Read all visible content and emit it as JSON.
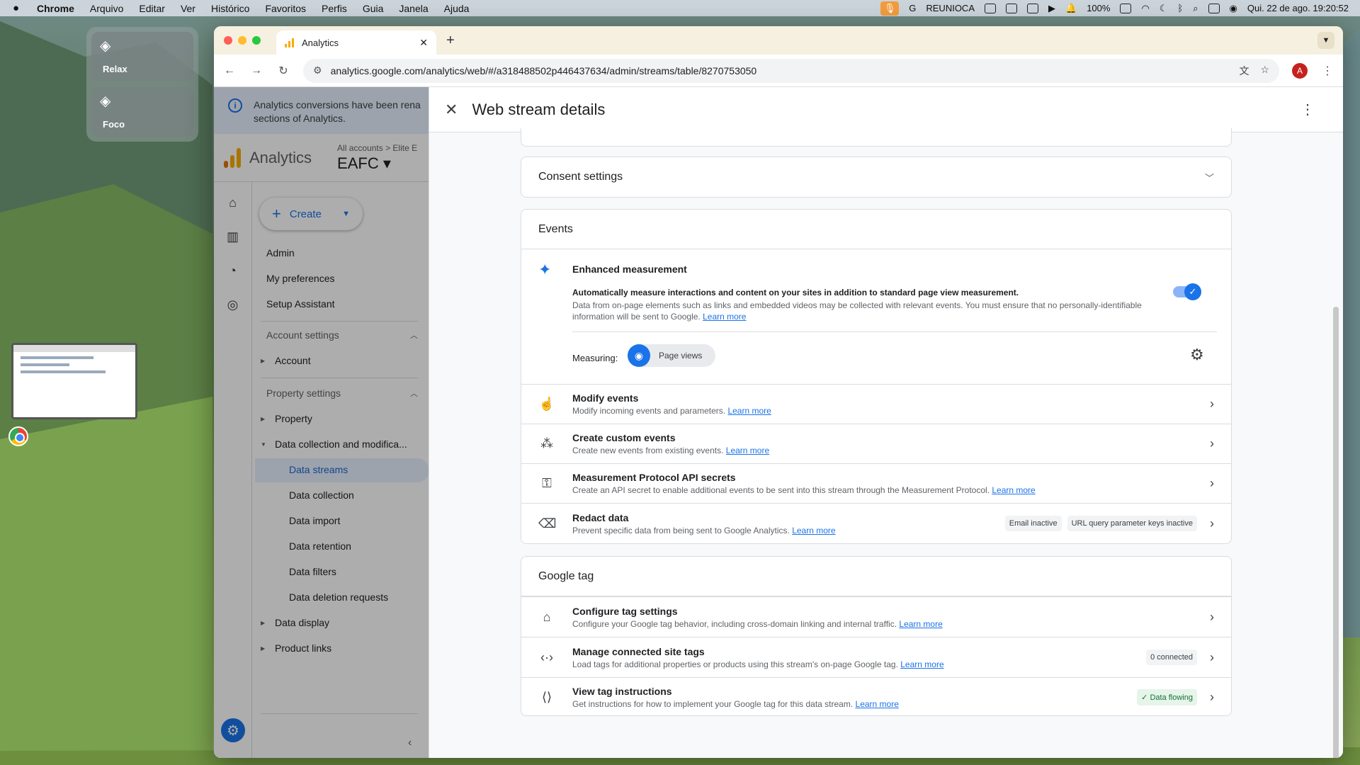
{
  "menubar": {
    "app": "Chrome",
    "items": [
      "Arquivo",
      "Editar",
      "Ver",
      "Histórico",
      "Favoritos",
      "Perfis",
      "Guia",
      "Janela",
      "Ajuda"
    ],
    "tray_label": "REUNIOCA",
    "battery": "100%",
    "datetime": "Qui. 22 de ago.  19:20:52"
  },
  "focus": {
    "relax": "Relax",
    "foco": "Foco"
  },
  "browser": {
    "tab_title": "Analytics",
    "url": "analytics.google.com/analytics/web/#/a318488502p446437634/admin/streams/table/8270753050",
    "avatar": "A"
  },
  "ga": {
    "banner": "Analytics conversions have been rena\nsections of Analytics.",
    "product": "Analytics",
    "breadcrumb": "All accounts  >  Elite E",
    "property": "EAFC ▾",
    "create": "Create",
    "nav": {
      "admin": "Admin",
      "prefs": "My preferences",
      "setup": "Setup Assistant",
      "account_settings": "Account settings",
      "account": "Account",
      "property_settings": "Property settings",
      "property": "Property",
      "data_collection_mod": "Data collection and modifica...",
      "data_streams": "Data streams",
      "data_collection": "Data collection",
      "data_import": "Data import",
      "data_retention": "Data retention",
      "data_filters": "Data filters",
      "data_deletion": "Data deletion requests",
      "data_display": "Data display",
      "product_links": "Product links"
    }
  },
  "panel": {
    "title": "Web stream details",
    "consent": "Consent settings",
    "events_title": "Events",
    "enhanced": {
      "title": "Enhanced measurement",
      "desc_bold": "Automatically measure interactions and content on your sites in addition to standard page view measurement.",
      "desc": "Data from on-page elements such as links and embedded videos may be collected with relevant events. You must ensure that no personally-identifiable information will be sent to Google.",
      "learn": "Learn more",
      "measuring": "Measuring:",
      "chip": "Page views",
      "enabled": true
    },
    "events_rows": [
      {
        "title": "Modify events",
        "desc": "Modify incoming events and parameters.",
        "learn": "Learn more"
      },
      {
        "title": "Create custom events",
        "desc": "Create new events from existing events.",
        "learn": "Learn more"
      },
      {
        "title": "Measurement Protocol API secrets",
        "desc": "Create an API secret to enable additional events to be sent into this stream through the Measurement Protocol.",
        "learn": "Learn more"
      },
      {
        "title": "Redact data",
        "desc": "Prevent specific data from being sent to Google Analytics.",
        "learn": "Learn more",
        "chip1": "Email inactive",
        "chip2": "URL query parameter keys inactive"
      }
    ],
    "gtag_title": "Google tag",
    "gtag_rows": [
      {
        "title": "Configure tag settings",
        "desc": "Configure your Google tag behavior, including cross-domain linking and internal traffic.",
        "learn": "Learn more"
      },
      {
        "title": "Manage connected site tags",
        "desc": "Load tags for additional properties or products using this stream's on-page Google tag.",
        "learn": "Learn more",
        "chip": "0 connected"
      },
      {
        "title": "View tag instructions",
        "desc": "Get instructions for how to implement your Google tag for this data stream.",
        "learn": "Learn more",
        "chip": "Data flowing"
      }
    ]
  }
}
